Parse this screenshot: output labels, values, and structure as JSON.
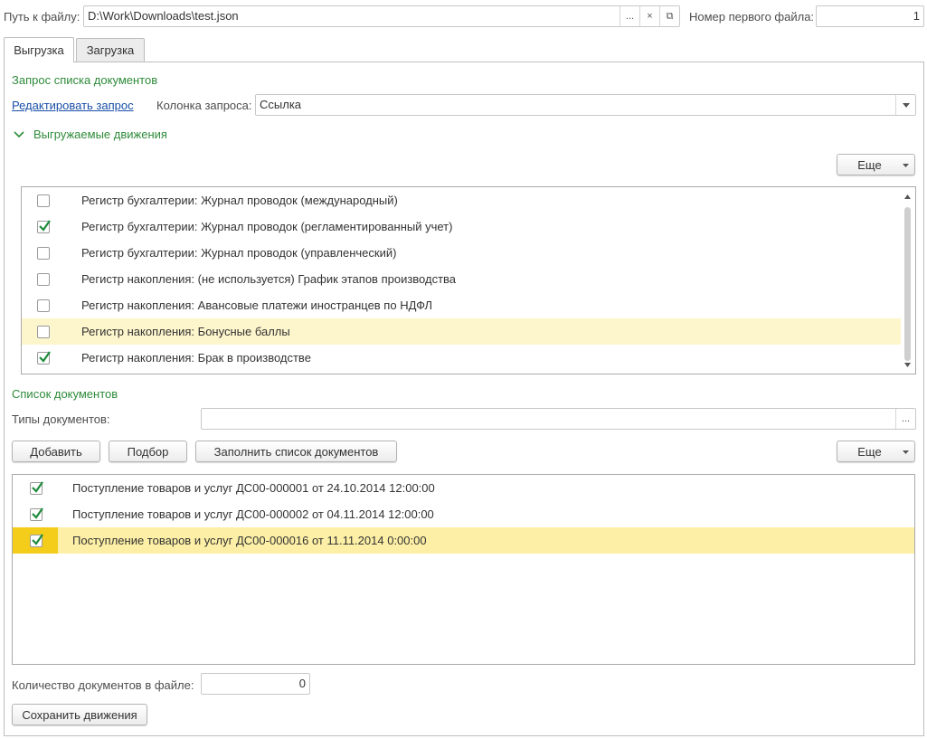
{
  "header": {
    "file_path_label": "Путь к файлу:",
    "file_path_value": "D:\\Work\\Downloads\\test.json",
    "browse_button": "...",
    "clear_button": "×",
    "open_button": "⧉",
    "first_file_label": "Номер первого файла:",
    "first_file_value": "1"
  },
  "tabs": [
    {
      "label": "Выгрузка",
      "active": true
    },
    {
      "label": "Загрузка",
      "active": false
    }
  ],
  "query_section": {
    "title": "Запрос списка документов",
    "edit_link": "Редактировать запрос",
    "column_label": "Колонка запроса:",
    "column_value": "Ссылка",
    "movements_title": "Выгружаемые движения",
    "more_button": "Еще"
  },
  "movements": [
    {
      "label": "Регистр бухгалтерии: Журнал проводок (международный)",
      "checked": false
    },
    {
      "label": "Регистр бухгалтерии: Журнал проводок (регламентированный учет)",
      "checked": true
    },
    {
      "label": "Регистр бухгалтерии: Журнал проводок (управленческий)",
      "checked": false
    },
    {
      "label": "Регистр накопления: (не используется) График этапов производства",
      "checked": false
    },
    {
      "label": "Регистр накопления: Авансовые платежи иностранцев по НДФЛ",
      "checked": false
    },
    {
      "label": "Регистр накопления: Бонусные баллы",
      "checked": false,
      "selected": true
    },
    {
      "label": "Регистр накопления: Брак в производстве",
      "checked": true
    }
  ],
  "documents_section": {
    "title": "Список документов",
    "types_label": "Типы документов:",
    "types_value": "",
    "types_button": "...",
    "add_button": "Добавить",
    "pick_button": "Подбор",
    "fill_button": "Заполнить список документов",
    "more_button": "Еще"
  },
  "documents": [
    {
      "label": "Поступление товаров и услуг ДС00-000001 от 24.10.2014 12:00:00",
      "checked": true
    },
    {
      "label": "Поступление товаров и услуг ДС00-000002 от 04.11.2014 12:00:00",
      "checked": true
    },
    {
      "label": "Поступление товаров и услуг ДС00-000016 от 11.11.2014 0:00:00",
      "checked": true,
      "selected": true
    }
  ],
  "footer": {
    "count_label": "Количество документов в файле:",
    "count_value": "0",
    "save_button": "Сохранить движения"
  },
  "colors": {
    "accent_green": "#2e8b3a",
    "link_blue": "#1a4ea8",
    "selection": "#fdf5cc",
    "selection_strong": "#fdf0a6",
    "selection_marker": "#f4cd1b"
  },
  "icons": {
    "check": "check-icon",
    "dropdown": "chevron-down-icon",
    "collapse": "chevron-down-icon",
    "scroll_up": "arrow-up-icon",
    "scroll_down": "arrow-down-icon"
  }
}
